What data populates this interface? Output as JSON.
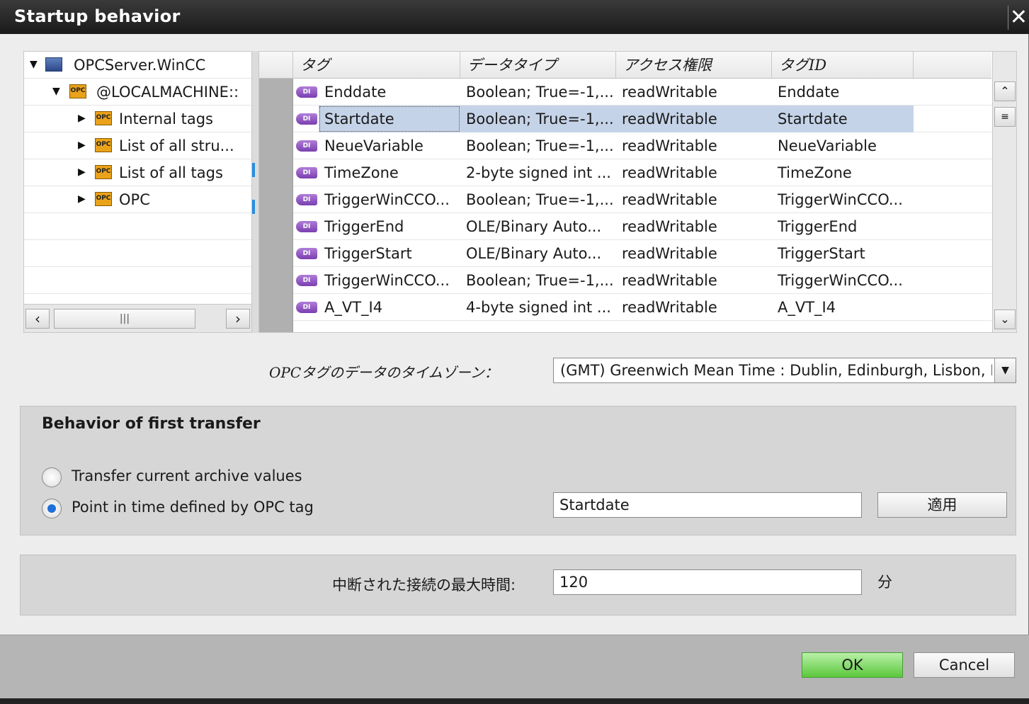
{
  "window": {
    "title": "Startup behavior",
    "close_glyph": "✕"
  },
  "tree": {
    "items": [
      {
        "label": "OPCServer.WinCC",
        "icon": "server-icon",
        "expanded": true,
        "level": 0
      },
      {
        "label": "@LOCALMACHINE::",
        "icon": "opc-folder-icon",
        "expanded": true,
        "level": 1
      },
      {
        "label": "Internal tags",
        "icon": "opc-folder-icon",
        "expanded": false,
        "level": 2
      },
      {
        "label": "List of all stru...",
        "icon": "opc-folder-icon",
        "expanded": false,
        "level": 2
      },
      {
        "label": "List of all tags",
        "icon": "opc-folder-icon",
        "expanded": false,
        "level": 2
      },
      {
        "label": "OPC",
        "icon": "opc-folder-icon",
        "expanded": false,
        "level": 2
      }
    ],
    "icon_text": "OPC",
    "scroll_thumb_glyph": "|||"
  },
  "grid": {
    "columns": [
      "タグ",
      "データタイプ",
      "アクセス権限",
      "タグID"
    ],
    "icon_text": "DI",
    "rows": [
      {
        "name": "Enddate",
        "type": "Boolean; True=-1,...",
        "access": "readWritable",
        "id": "Enddate"
      },
      {
        "name": "Startdate",
        "type": "Boolean; True=-1,...",
        "access": "readWritable",
        "id": "Startdate",
        "selected": true
      },
      {
        "name": "NeueVariable",
        "type": "Boolean; True=-1,...",
        "access": "readWritable",
        "id": "NeueVariable"
      },
      {
        "name": "TimeZone",
        "type": "2-byte signed int ...",
        "access": "readWritable",
        "id": "TimeZone"
      },
      {
        "name": "TriggerWinCCO...",
        "type": "Boolean; True=-1,...",
        "access": "readWritable",
        "id": "TriggerWinCCO..."
      },
      {
        "name": "TriggerEnd",
        "type": "OLE/Binary Auto...",
        "access": "readWritable",
        "id": "TriggerEnd"
      },
      {
        "name": "TriggerStart",
        "type": "OLE/Binary Auto...",
        "access": "readWritable",
        "id": "TriggerStart"
      },
      {
        "name": "TriggerWinCCO...",
        "type": "Boolean; True=-1,...",
        "access": "readWritable",
        "id": "TriggerWinCCO..."
      },
      {
        "name": "A_VT_I4",
        "type": "4-byte signed int ...",
        "access": "readWritable",
        "id": "A_VT_I4"
      }
    ]
  },
  "timezone": {
    "label": "OPCタグのデータのタイムゾーン：",
    "value": "(GMT) Greenwich Mean Time : Dublin, Edinburgh, Lisbon, London"
  },
  "first_transfer": {
    "title": "Behavior of first transfer",
    "option1": "Transfer current archive values",
    "option2": "Point in time defined by OPC tag",
    "selected": "option2",
    "tag_value": "Startdate",
    "apply_label": "適用"
  },
  "connection": {
    "label": "中断された接続の最大時間:",
    "value": "120",
    "unit": "分"
  },
  "footer": {
    "ok": "OK",
    "cancel": "Cancel"
  },
  "colors": {
    "selection": "#c5d3e8",
    "ok_button": "#5cc83c",
    "accent": "#1e6fd9"
  }
}
